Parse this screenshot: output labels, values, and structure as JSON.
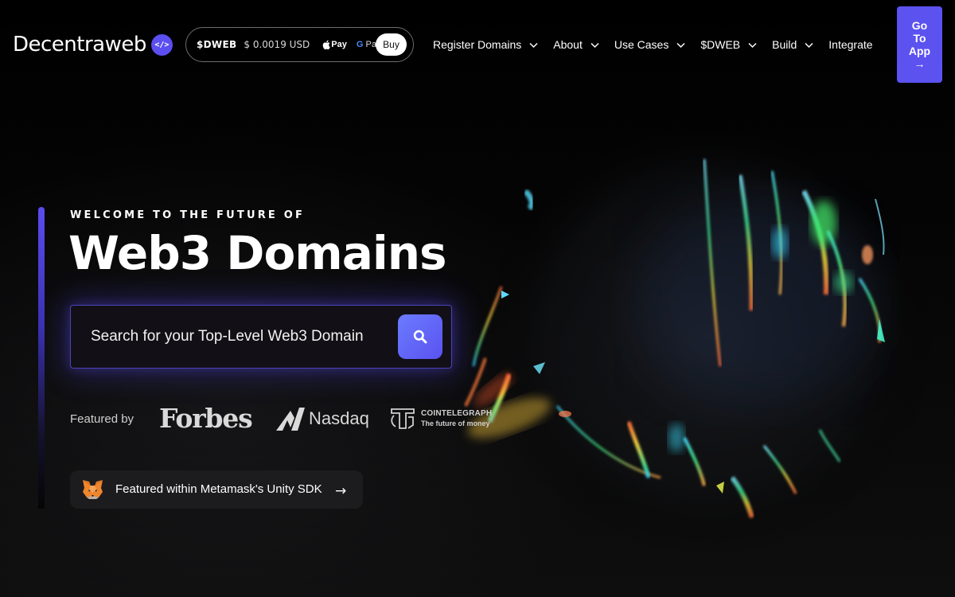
{
  "header": {
    "logo_text": "Decentraweb",
    "logo_badge_icon": "code-brackets-icon",
    "logo_badge_text": "</>",
    "token": {
      "name": "$DWEB",
      "price": "$ 0.0019 USD",
      "apple_pay": "Pay",
      "google_pay_g": "G",
      "google_pay_text": " Pay",
      "buy_label": "Buy"
    },
    "nav": [
      {
        "label": "Register Domains",
        "has_dropdown": true
      },
      {
        "label": "About",
        "has_dropdown": true
      },
      {
        "label": "Use Cases",
        "has_dropdown": true
      },
      {
        "label": "$DWEB",
        "has_dropdown": true
      },
      {
        "label": "Build",
        "has_dropdown": true
      },
      {
        "label": "Integrate",
        "has_dropdown": false
      }
    ],
    "go_to_app": {
      "line1": "Go",
      "line2": "To",
      "line3": "App",
      "arrow": "→"
    }
  },
  "hero": {
    "eyebrow": "WELCOME TO THE FUTURE OF",
    "headline": "Web3 Domains",
    "search": {
      "placeholder": "Search for your Top-Level Web3 Domain",
      "value": "",
      "button_icon": "search-icon"
    },
    "featured": {
      "label": "Featured by",
      "logos": {
        "forbes": "Forbes",
        "nasdaq": "Nasdaq",
        "cointelegraph_name": "COINTELEGRAPH",
        "cointelegraph_tagline": "The future of money"
      }
    },
    "metamask": {
      "icon": "metamask-fox-icon",
      "label": "Featured within Metamask's Unity SDK",
      "arrow": "→"
    }
  },
  "colors": {
    "accent": "#5b52f0",
    "background": "#000000",
    "search_glow": "#5846ff",
    "pill_bg": "#1c1c1e"
  }
}
